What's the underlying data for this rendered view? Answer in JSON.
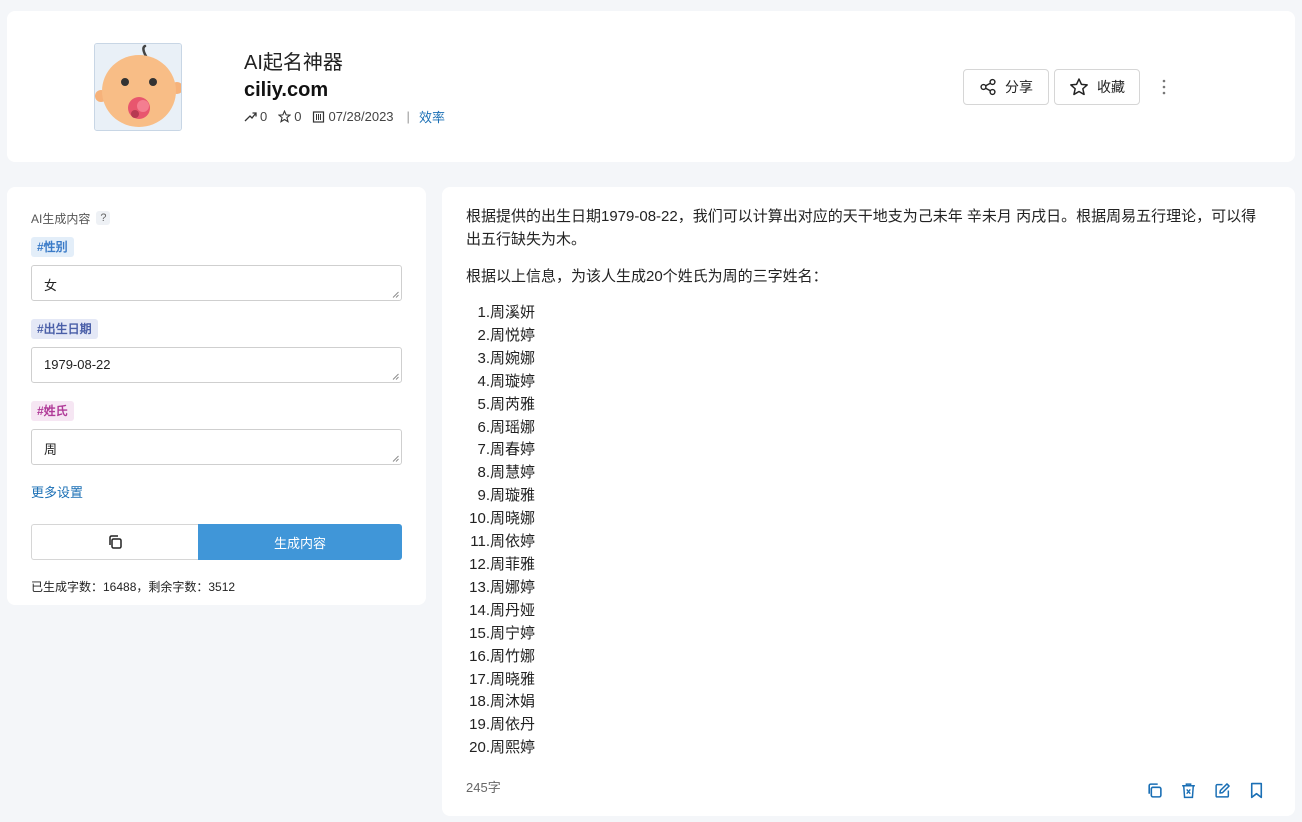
{
  "header": {
    "title": "AI起名神器",
    "domain": "ciliy.com",
    "trend_count": "0",
    "star_count": "0",
    "date": "07/28/2023",
    "separator": "|",
    "category": "效率",
    "share_label": "分享",
    "favorite_label": "收藏"
  },
  "form": {
    "section_title": "AI生成内容",
    "help_mark": "?",
    "fields": [
      {
        "tag": "#性别",
        "value": "女"
      },
      {
        "tag": "#出生日期",
        "value": "1979-08-22"
      },
      {
        "tag": "#姓氏",
        "value": "周"
      }
    ],
    "more_settings": "更多设置",
    "generate_label": "生成内容",
    "stats": "已生成字数：16488，剩余字数：3512"
  },
  "result": {
    "intro": "根据提供的出生日期1979-08-22，我们可以计算出对应的天干地支为己未年 辛未月 丙戌日。根据周易五行理论，可以得出五行缺失为木。",
    "lead": "根据以上信息，为该人生成20个姓氏为周的三字姓名：",
    "names": [
      {
        "num": "1.",
        "name": "周溪妍"
      },
      {
        "num": "2.",
        "name": "周悦婷"
      },
      {
        "num": "3.",
        "name": "周婉娜"
      },
      {
        "num": "4.",
        "name": "周璇婷"
      },
      {
        "num": "5.",
        "name": "周芮雅"
      },
      {
        "num": "6.",
        "name": "周瑶娜"
      },
      {
        "num": "7.",
        "name": "周春婷"
      },
      {
        "num": "8.",
        "name": "周慧婷"
      },
      {
        "num": "9.",
        "name": "周璇雅"
      },
      {
        "num": "10.",
        "name": "周晓娜"
      },
      {
        "num": "11.",
        "name": "周依婷"
      },
      {
        "num": "12.",
        "name": "周菲雅"
      },
      {
        "num": "13.",
        "name": "周娜婷"
      },
      {
        "num": "14.",
        "name": "周丹娅"
      },
      {
        "num": "15.",
        "name": "周宁婷"
      },
      {
        "num": "16.",
        "name": "周竹娜"
      },
      {
        "num": "17.",
        "name": "周晓雅"
      },
      {
        "num": "18.",
        "name": "周沐娟"
      },
      {
        "num": "19.",
        "name": "周依丹"
      },
      {
        "num": "20.",
        "name": "周熙婷"
      }
    ],
    "word_count": "245字"
  }
}
